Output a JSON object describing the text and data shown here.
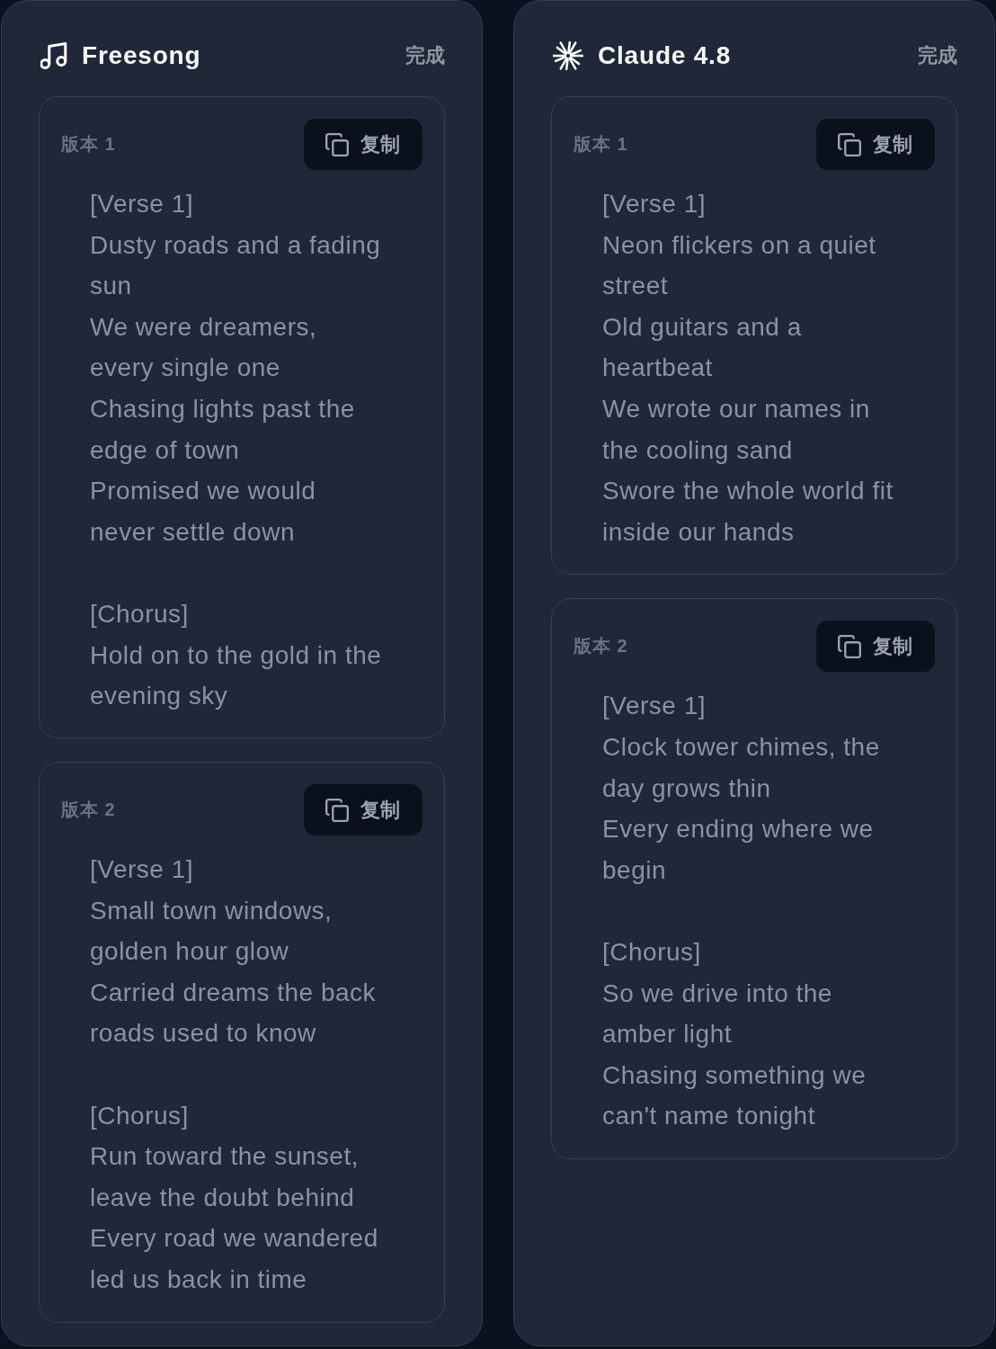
{
  "panels": [
    {
      "kind": "music",
      "title": "Freesong",
      "status": "完成",
      "versions": [
        {
          "label": "版本 1",
          "copy_button": "复制",
          "sections": [
            {
              "heading": "[Verse 1]",
              "lines": [
                "Dusty roads and a fading sun",
                "We were dreamers, every single one",
                "Chasing lights past the edge of town",
                "Promised we would never settle down"
              ]
            },
            {
              "heading": "[Chorus]",
              "lines": [
                "Hold on to the gold in the evening sky"
              ]
            }
          ]
        },
        {
          "label": "版本 2",
          "copy_button": "复制",
          "sections": [
            {
              "heading": "[Verse 1]",
              "lines": [
                "Small town windows, golden hour glow",
                "Carried dreams the back roads used to know"
              ]
            },
            {
              "heading": "[Chorus]",
              "lines": [
                "Run toward the sunset, leave the doubt behind",
                "Every road we wandered led us back in time"
              ]
            }
          ]
        }
      ]
    },
    {
      "kind": "assistant",
      "title": "Claude 4.8",
      "status": "完成",
      "versions": [
        {
          "label": "版本 1",
          "copy_button": "复制",
          "sections": [
            {
              "heading": "[Verse 1]",
              "lines": [
                "Neon flickers on a quiet street",
                "Old guitars and a heartbeat",
                "We wrote our names in the cooling sand",
                "Swore the whole world fit inside our hands"
              ]
            }
          ]
        },
        {
          "label": "版本 2",
          "copy_button": "复制",
          "sections": [
            {
              "heading": "[Verse 1]",
              "lines": [
                "Clock tower chimes, the day grows thin",
                "Every ending where we begin"
              ]
            },
            {
              "heading": "[Chorus]",
              "lines": [
                "So we drive into the amber light",
                "Chasing something we can't name tonight"
              ]
            }
          ]
        }
      ]
    }
  ]
}
